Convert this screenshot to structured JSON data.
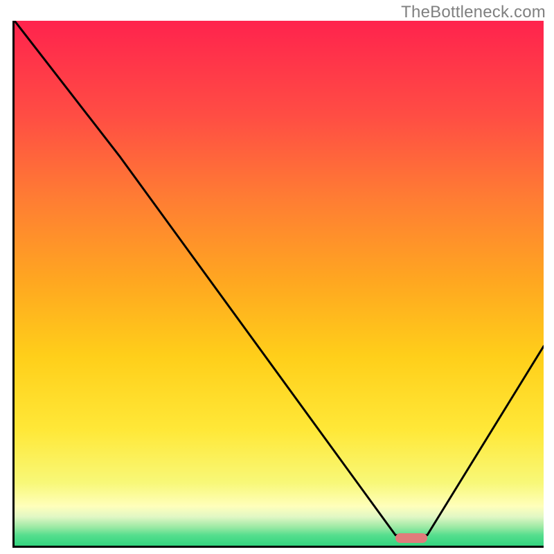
{
  "watermark": "TheBottleneck.com",
  "chart_data": {
    "type": "line",
    "title": "",
    "xlabel": "",
    "ylabel": "",
    "xlim": [
      0,
      100
    ],
    "ylim": [
      0,
      100
    ],
    "grid": false,
    "legend": false,
    "series": [
      {
        "name": "bottleneck-curve",
        "x": [
          0,
          20,
          72,
          78,
          100
        ],
        "values": [
          100,
          74,
          2,
          2,
          38
        ]
      }
    ],
    "marker": {
      "name": "optimal-range",
      "x_start": 72,
      "x_end": 78,
      "y": 1.5,
      "color": "#e07b7b"
    },
    "background_bands": [
      {
        "color": "#ff234d",
        "y_from": 100,
        "y_to": 86
      },
      {
        "color": "#ff5a3c",
        "y_from": 86,
        "y_to": 70
      },
      {
        "color": "#ff8a2e",
        "y_from": 70,
        "y_to": 54
      },
      {
        "color": "#ffb41e",
        "y_from": 54,
        "y_to": 38
      },
      {
        "color": "#ffd91a",
        "y_from": 38,
        "y_to": 24
      },
      {
        "color": "#fcf03a",
        "y_from": 24,
        "y_to": 14
      },
      {
        "color": "#f2f97e",
        "y_from": 14,
        "y_to": 9
      },
      {
        "color": "#ffffbb",
        "y_from": 9,
        "y_to": 6
      },
      {
        "color": "#c4f4b0",
        "y_from": 6,
        "y_to": 3
      },
      {
        "color": "#4de08c",
        "y_from": 3,
        "y_to": 0
      }
    ]
  }
}
